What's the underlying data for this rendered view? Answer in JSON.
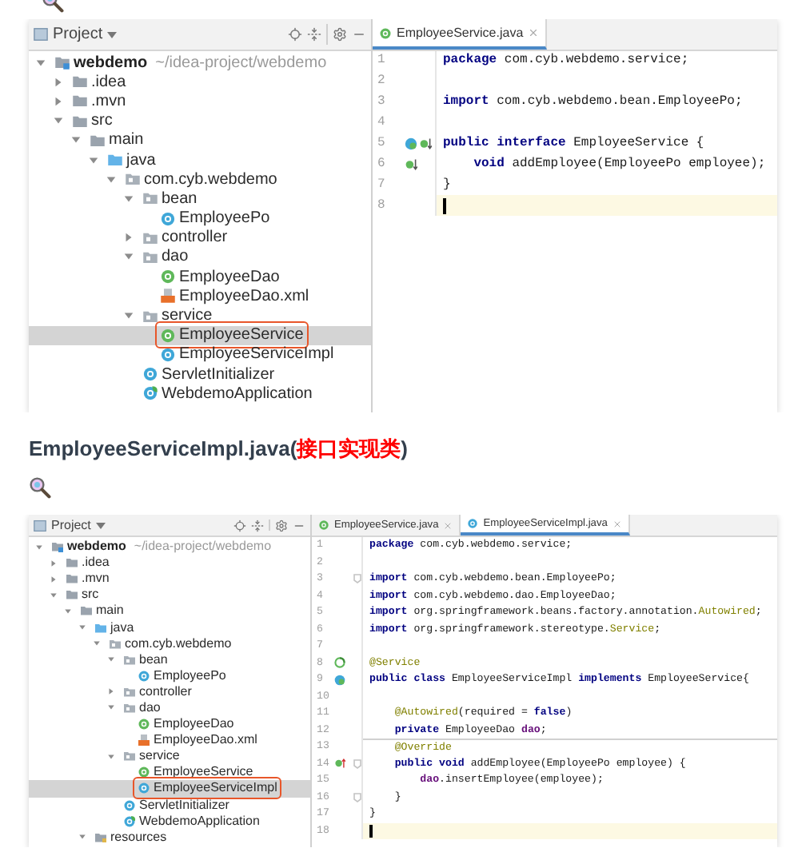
{
  "top_screenshot": {
    "project_label": "Project",
    "tree": [
      {
        "label": "webdemo",
        "path": "~/idea-project/webdemo",
        "kind": "module",
        "expanded": true,
        "selected": false,
        "outlined": false,
        "children": [
          {
            "label": ".idea",
            "kind": "folder",
            "expanded": false,
            "selected": false,
            "outlined": false
          },
          {
            "label": ".mvn",
            "kind": "folder",
            "expanded": false,
            "selected": false,
            "outlined": false
          },
          {
            "label": "src",
            "kind": "folder",
            "expanded": true,
            "selected": false,
            "outlined": false,
            "children": [
              {
                "label": "main",
                "kind": "folder",
                "expanded": true,
                "selected": false,
                "outlined": false,
                "children": [
                  {
                    "label": "java",
                    "kind": "source",
                    "expanded": true,
                    "selected": false,
                    "outlined": false,
                    "children": [
                      {
                        "label": "com.cyb.webdemo",
                        "kind": "package",
                        "expanded": true,
                        "selected": false,
                        "outlined": false,
                        "children": [
                          {
                            "label": "bean",
                            "kind": "package",
                            "expanded": true,
                            "selected": false,
                            "outlined": false,
                            "children": [
                              {
                                "label": "EmployeePo",
                                "kind": "class",
                                "selected": false,
                                "outlined": false
                              }
                            ]
                          },
                          {
                            "label": "controller",
                            "kind": "package",
                            "expanded": false,
                            "selected": false,
                            "outlined": false
                          },
                          {
                            "label": "dao",
                            "kind": "package",
                            "expanded": true,
                            "selected": false,
                            "outlined": false,
                            "children": [
                              {
                                "label": "EmployeeDao",
                                "kind": "interface",
                                "selected": false,
                                "outlined": false
                              },
                              {
                                "label": "EmployeeDao.xml",
                                "kind": "xml",
                                "selected": false,
                                "outlined": false
                              }
                            ]
                          },
                          {
                            "label": "service",
                            "kind": "package",
                            "expanded": true,
                            "selected": false,
                            "outlined": false,
                            "children": [
                              {
                                "label": "EmployeeService",
                                "kind": "interface",
                                "selected": true,
                                "outlined": true
                              },
                              {
                                "label": "EmployeeServiceImpl",
                                "kind": "class",
                                "selected": false,
                                "outlined": false
                              }
                            ]
                          },
                          {
                            "label": "ServletInitializer",
                            "kind": "class",
                            "selected": false,
                            "outlined": false
                          },
                          {
                            "label": "WebdemoApplication",
                            "kind": "spring",
                            "selected": false,
                            "outlined": false
                          }
                        ]
                      }
                    ]
                  }
                ]
              }
            ]
          }
        ]
      }
    ],
    "tabs": [
      {
        "label": "EmployeeService.java",
        "kind": "interface",
        "selected": true
      }
    ],
    "code": [
      {
        "number": "1",
        "current": false,
        "tokens": [
          {
            "text": "package",
            "kind": "kw"
          },
          {
            "text": " com.cyb.webdemo.service;",
            "kind": "plain"
          }
        ]
      },
      {
        "number": "2",
        "current": false
      },
      {
        "number": "3",
        "current": false,
        "tokens": [
          {
            "text": "import",
            "kind": "kw"
          },
          {
            "text": " com.cyb.webdemo.bean.EmployeePo;",
            "kind": "plain"
          }
        ]
      },
      {
        "number": "4",
        "current": false
      },
      {
        "number": "5",
        "current": false,
        "gutter": [
          {
            "kind": "implemented"
          },
          {
            "kind": "implementing-down"
          }
        ],
        "tokens": [
          {
            "text": "public interface",
            "kind": "kw"
          },
          {
            "text": " EmployeeService {",
            "kind": "plain"
          }
        ]
      },
      {
        "number": "6",
        "current": false,
        "gutter": [
          {
            "kind": "implementing-down"
          }
        ],
        "tokens": [
          {
            "text": "    void",
            "kind": "kw"
          },
          {
            "text": " addEmployee(EmployeePo employee);",
            "kind": "plain"
          }
        ]
      },
      {
        "number": "7",
        "current": false,
        "tokens": [
          {
            "text": "}",
            "kind": "plain"
          }
        ]
      },
      {
        "number": "8",
        "current": true
      }
    ]
  },
  "heading": [
    {
      "text": "EmployeeServiceImpl.java(",
      "color": "#333f4d"
    },
    {
      "text": "接口实现类",
      "color": "#ff0000"
    },
    {
      "text": ")",
      "color": "#333f4d"
    }
  ],
  "bottom_screenshot": {
    "project_label": "Project",
    "tree": [
      {
        "label": "webdemo",
        "path": "~/idea-project/webdemo",
        "kind": "module",
        "expanded": true,
        "selected": false,
        "outlined": false,
        "children": [
          {
            "label": ".idea",
            "kind": "folder",
            "expanded": false,
            "selected": false,
            "outlined": false
          },
          {
            "label": ".mvn",
            "kind": "folder",
            "expanded": false,
            "selected": false,
            "outlined": false
          },
          {
            "label": "src",
            "kind": "folder",
            "expanded": true,
            "selected": false,
            "outlined": false,
            "children": [
              {
                "label": "main",
                "kind": "folder",
                "expanded": true,
                "selected": false,
                "outlined": false,
                "children": [
                  {
                    "label": "java",
                    "kind": "source",
                    "expanded": true,
                    "selected": false,
                    "outlined": false,
                    "children": [
                      {
                        "label": "com.cyb.webdemo",
                        "kind": "package",
                        "expanded": true,
                        "selected": false,
                        "outlined": false,
                        "children": [
                          {
                            "label": "bean",
                            "kind": "package",
                            "expanded": true,
                            "selected": false,
                            "outlined": false,
                            "children": [
                              {
                                "label": "EmployeePo",
                                "kind": "class",
                                "selected": false,
                                "outlined": false
                              }
                            ]
                          },
                          {
                            "label": "controller",
                            "kind": "package",
                            "expanded": false,
                            "selected": false,
                            "outlined": false
                          },
                          {
                            "label": "dao",
                            "kind": "package",
                            "expanded": true,
                            "selected": false,
                            "outlined": false,
                            "children": [
                              {
                                "label": "EmployeeDao",
                                "kind": "interface",
                                "selected": false,
                                "outlined": false
                              },
                              {
                                "label": "EmployeeDao.xml",
                                "kind": "xml",
                                "selected": false,
                                "outlined": false
                              }
                            ]
                          },
                          {
                            "label": "service",
                            "kind": "package",
                            "expanded": true,
                            "selected": false,
                            "outlined": false,
                            "children": [
                              {
                                "label": "EmployeeService",
                                "kind": "interface",
                                "selected": false,
                                "outlined": false
                              },
                              {
                                "label": "EmployeeServiceImpl",
                                "kind": "class",
                                "selected": true,
                                "outlined": true
                              }
                            ]
                          },
                          {
                            "label": "ServletInitializer",
                            "kind": "class",
                            "selected": false,
                            "outlined": false
                          },
                          {
                            "label": "WebdemoApplication",
                            "kind": "spring",
                            "selected": false,
                            "outlined": false
                          }
                        ]
                      }
                    ]
                  },
                  {
                    "label": "resources",
                    "kind": "resources",
                    "expanded": true,
                    "selected": false,
                    "outlined": false
                  }
                ]
              }
            ]
          }
        ]
      }
    ],
    "tabs": [
      {
        "label": "EmployeeService.java",
        "kind": "interface",
        "selected": false
      },
      {
        "label": "EmployeeServiceImpl.java",
        "kind": "class",
        "selected": true
      }
    ],
    "code": [
      {
        "number": "1",
        "current": false,
        "tokens": [
          {
            "text": "package",
            "kind": "kw"
          },
          {
            "text": " com.cyb.webdemo.service;",
            "kind": "plain"
          }
        ]
      },
      {
        "number": "2",
        "current": false
      },
      {
        "number": "3",
        "current": false,
        "fold": true,
        "tokens": [
          {
            "text": "import",
            "kind": "kw"
          },
          {
            "text": " com.cyb.webdemo.bean.EmployeePo;",
            "kind": "plain"
          }
        ]
      },
      {
        "number": "4",
        "current": false,
        "tokens": [
          {
            "text": "import",
            "kind": "kw"
          },
          {
            "text": " com.cyb.webdemo.dao.EmployeeDao;",
            "kind": "plain"
          }
        ]
      },
      {
        "number": "5",
        "current": false,
        "tokens": [
          {
            "text": "import",
            "kind": "kw"
          },
          {
            "text": " org.springframework.beans.factory.annotation.",
            "kind": "plain"
          },
          {
            "text": "Autowired",
            "kind": "ann"
          },
          {
            "text": ";",
            "kind": "plain"
          }
        ]
      },
      {
        "number": "6",
        "current": false,
        "tokens": [
          {
            "text": "import",
            "kind": "kw"
          },
          {
            "text": " org.springframework.stereotype.",
            "kind": "plain"
          },
          {
            "text": "Service",
            "kind": "ann"
          },
          {
            "text": ";",
            "kind": "plain"
          }
        ]
      },
      {
        "number": "7",
        "current": false
      },
      {
        "number": "8",
        "current": false,
        "gutter": [
          {
            "kind": "bean"
          }
        ],
        "tokens": [
          {
            "text": "@Service",
            "kind": "ann"
          }
        ]
      },
      {
        "number": "9",
        "current": false,
        "gutter": [
          {
            "kind": "implemented"
          }
        ],
        "tokens": [
          {
            "text": "public class",
            "kind": "kw"
          },
          {
            "text": " EmployeeServiceImpl ",
            "kind": "plain"
          },
          {
            "text": "implements",
            "kind": "kw"
          },
          {
            "text": " EmployeeService{",
            "kind": "plain"
          }
        ]
      },
      {
        "number": "10",
        "current": false
      },
      {
        "number": "11",
        "current": false,
        "tokens": [
          {
            "text": "    @Autowired",
            "kind": "ann"
          },
          {
            "text": "(required = ",
            "kind": "plain"
          },
          {
            "text": "false",
            "kind": "kw"
          },
          {
            "text": ")",
            "kind": "plain"
          }
        ]
      },
      {
        "number": "12",
        "current": false,
        "tokens": [
          {
            "text": "    private",
            "kind": "kw"
          },
          {
            "text": " EmployeeDao ",
            "kind": "plain"
          },
          {
            "text": "dao",
            "kind": "field"
          },
          {
            "text": ";",
            "kind": "plain"
          }
        ]
      },
      {
        "number": "13",
        "current": false,
        "separator_above": true,
        "tokens": [
          {
            "text": "    @Override",
            "kind": "ann"
          }
        ]
      },
      {
        "number": "14",
        "current": false,
        "fold": true,
        "gutter": [
          {
            "kind": "overriding-up"
          }
        ],
        "tokens": [
          {
            "text": "    public void",
            "kind": "kw"
          },
          {
            "text": " addEmployee(EmployeePo employee) {",
            "kind": "plain"
          }
        ]
      },
      {
        "number": "15",
        "current": false,
        "tokens": [
          {
            "text": "        dao",
            "kind": "field"
          },
          {
            "text": ".insertEmployee(employee);",
            "kind": "plain"
          }
        ]
      },
      {
        "number": "16",
        "current": false,
        "fold": true,
        "tokens": [
          {
            "text": "    }",
            "kind": "plain"
          }
        ]
      },
      {
        "number": "17",
        "current": false,
        "tokens": [
          {
            "text": "}",
            "kind": "plain"
          }
        ]
      },
      {
        "number": "18",
        "current": true
      }
    ]
  }
}
